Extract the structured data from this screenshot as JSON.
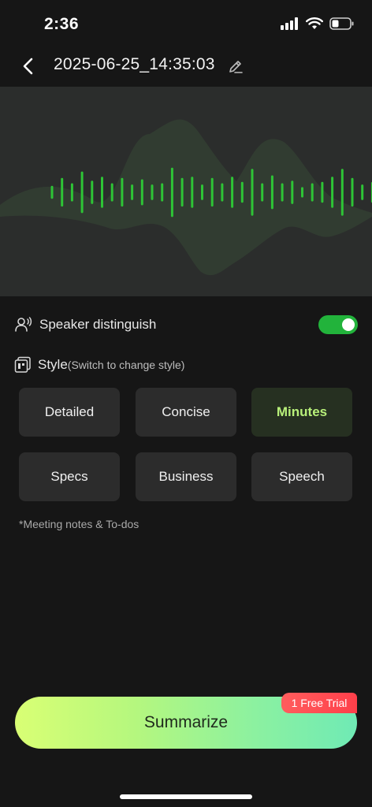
{
  "status_bar": {
    "time": "2:36"
  },
  "header": {
    "title": "2025-06-25_14:35:03"
  },
  "speaker": {
    "label": "Speaker distinguish",
    "enabled": true
  },
  "style": {
    "label": "Style",
    "hint": "(Switch to change style)",
    "options": [
      {
        "label": "Detailed",
        "selected": false
      },
      {
        "label": "Concise",
        "selected": false
      },
      {
        "label": "Minutes",
        "selected": true
      },
      {
        "label": "Specs",
        "selected": false
      },
      {
        "label": "Business",
        "selected": false
      },
      {
        "label": "Speech",
        "selected": false
      }
    ],
    "note": "*Meeting notes & To-dos"
  },
  "summarize": {
    "label": "Summarize",
    "badge": "1 Free Trial"
  },
  "colors": {
    "accent_green": "#22b33b",
    "selected_text": "#b8f07a",
    "badge_red": "#ff4a4f"
  },
  "waveform": {
    "bar_levels": [
      0.25,
      0.55,
      0.35,
      0.8,
      0.45,
      0.6,
      0.35,
      0.55,
      0.3,
      0.5,
      0.3,
      0.35,
      0.95,
      0.55,
      0.6,
      0.3,
      0.55,
      0.35,
      0.6,
      0.4,
      0.9,
      0.35,
      0.65,
      0.35,
      0.45,
      0.2,
      0.35,
      0.4,
      0.6,
      0.9,
      0.55,
      0.3,
      0.4,
      0.6,
      0.4,
      0.25,
      0.3
    ]
  }
}
